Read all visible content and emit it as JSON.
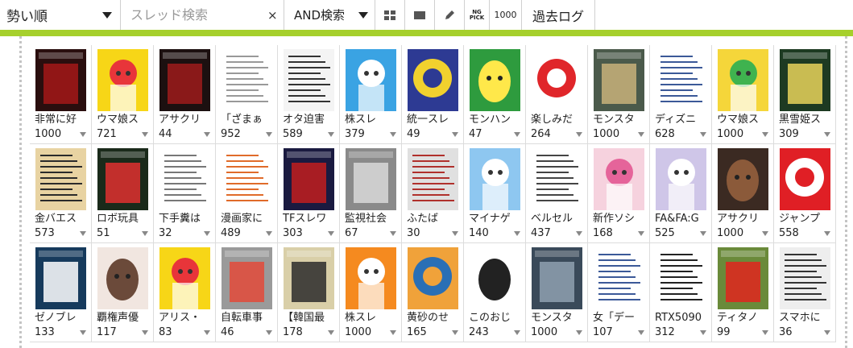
{
  "toolbar": {
    "sort_label": "勢い順",
    "search_placeholder": "スレッド検索",
    "search_clear": "×",
    "match_mode": "AND検索",
    "ng_pick_line1": "NG",
    "ng_pick_line2": "PICK",
    "count_label": "1000",
    "past_log": "過去ログ"
  },
  "colors": {
    "accent_bar": "#a6d02c"
  },
  "threads": [
    [
      {
        "title": "非常に好",
        "count": "1000",
        "bg": "#2a0e0e",
        "fg": "#a31818",
        "shape": "cover"
      },
      {
        "title": "ウマ娘ス",
        "count": "721",
        "bg": "#f7d617",
        "fg": "#e8353a",
        "shape": "anime"
      },
      {
        "title": "アサクリ",
        "count": "44",
        "bg": "#1c1010",
        "fg": "#9e1b1b",
        "shape": "cover"
      },
      {
        "title": "「ざまぁ",
        "count": "952",
        "bg": "#ffffff",
        "fg": "#999999",
        "shape": "doc"
      },
      {
        "title": "オタ迫害",
        "count": "589",
        "bg": "#f4f4f4",
        "fg": "#333333",
        "shape": "doc"
      },
      {
        "title": "株スレ",
        "count": "379",
        "bg": "#3aa3e3",
        "fg": "#ffffff",
        "shape": "anime"
      },
      {
        "title": "統一スレ",
        "count": "49",
        "bg": "#2d3a93",
        "fg": "#f1d12e",
        "shape": "circle"
      },
      {
        "title": "モンハン",
        "count": "47",
        "bg": "#2e9b3e",
        "fg": "#ffe84a",
        "shape": "face"
      },
      {
        "title": "楽しみだ",
        "count": "264",
        "bg": "#ffffff",
        "fg": "#e0262a",
        "shape": "circle"
      },
      {
        "title": "モンスタ",
        "count": "1000",
        "bg": "#4b5a4b",
        "fg": "#c8b27a",
        "shape": "cover"
      },
      {
        "title": "ディズニ",
        "count": "628",
        "bg": "#ffffff",
        "fg": "#3b5998",
        "shape": "doc"
      },
      {
        "title": "ウマ娘ス",
        "count": "1000",
        "bg": "#f5d63a",
        "fg": "#3fb34f",
        "shape": "anime"
      },
      {
        "title": "黒雪姫ス",
        "count": "309",
        "bg": "#1d3a22",
        "fg": "#e8d45a",
        "shape": "cover"
      }
    ],
    [
      {
        "title": "金バエス",
        "count": "573",
        "bg": "#e8d3a2",
        "fg": "#2b2b2b",
        "shape": "doc"
      },
      {
        "title": "ロボ玩具",
        "count": "51",
        "bg": "#1a2a1a",
        "fg": "#e03030",
        "shape": "cover"
      },
      {
        "title": "下手糞は",
        "count": "32",
        "bg": "#ffffff",
        "fg": "#777777",
        "shape": "doc"
      },
      {
        "title": "漫画家に",
        "count": "489",
        "bg": "#ffffff",
        "fg": "#e06b2a",
        "shape": "doc"
      },
      {
        "title": "TFスレワ",
        "count": "303",
        "bg": "#1a1a40",
        "fg": "#c21e1e",
        "shape": "cover"
      },
      {
        "title": "監視社会",
        "count": "67",
        "bg": "#8a8a8a",
        "fg": "#d8d8d8",
        "shape": "cover"
      },
      {
        "title": "ふたば",
        "count": "30",
        "bg": "#e0e0e0",
        "fg": "#b0302c",
        "shape": "doc"
      },
      {
        "title": "マイナゲ",
        "count": "140",
        "bg": "#8ec7f0",
        "fg": "#ffffff",
        "shape": "anime"
      },
      {
        "title": "ベルセル",
        "count": "437",
        "bg": "#ffffff",
        "fg": "#444444",
        "shape": "doc"
      },
      {
        "title": "新作ソシ",
        "count": "168",
        "bg": "#f6d2de",
        "fg": "#e5649a",
        "shape": "anime"
      },
      {
        "title": "FA&FA:G",
        "count": "525",
        "bg": "#cfc6e8",
        "fg": "#ffffff",
        "shape": "anime"
      },
      {
        "title": "アサクリ",
        "count": "1000",
        "bg": "#3b2a22",
        "fg": "#8b5a3a",
        "shape": "face"
      },
      {
        "title": "ジャンプ",
        "count": "558",
        "bg": "#e01f25",
        "fg": "#ffffff",
        "shape": "circle"
      }
    ],
    [
      {
        "title": "ゼノブレ",
        "count": "133",
        "bg": "#163a5c",
        "fg": "#ffffff",
        "shape": "cover"
      },
      {
        "title": "覇権声優",
        "count": "117",
        "bg": "#f1e6e0",
        "fg": "#6b4a3a",
        "shape": "face"
      },
      {
        "title": "アリス・",
        "count": "83",
        "bg": "#f7d617",
        "fg": "#e8353a",
        "shape": "anime"
      },
      {
        "title": "自転車事",
        "count": "46",
        "bg": "#9a9a9a",
        "fg": "#e34a3a",
        "shape": "cover"
      },
      {
        "title": "【韓国最",
        "count": "178",
        "bg": "#d9cfa8",
        "fg": "#2b2b2b",
        "shape": "cover"
      },
      {
        "title": "株スレ",
        "count": "1000",
        "bg": "#f58a1f",
        "fg": "#ffffff",
        "shape": "anime"
      },
      {
        "title": "黄砂のせ",
        "count": "165",
        "bg": "#f0a23a",
        "fg": "#2a6fb5",
        "shape": "circle"
      },
      {
        "title": "このおじ",
        "count": "243",
        "bg": "#ffffff",
        "fg": "#222222",
        "shape": "face"
      },
      {
        "title": "モンスタ",
        "count": "1000",
        "bg": "#3a4a5a",
        "fg": "#8fa0b0",
        "shape": "cover"
      },
      {
        "title": "女「デー",
        "count": "107",
        "bg": "#ffffff",
        "fg": "#3b5998",
        "shape": "doc"
      },
      {
        "title": "RTX5090",
        "count": "312",
        "bg": "#ffffff",
        "fg": "#222222",
        "shape": "doc"
      },
      {
        "title": "ティタノ",
        "count": "99",
        "bg": "#6a8a3a",
        "fg": "#e0251f",
        "shape": "cover"
      },
      {
        "title": "スマホに",
        "count": "36",
        "bg": "#eeeeee",
        "fg": "#333333",
        "shape": "doc"
      }
    ]
  ]
}
